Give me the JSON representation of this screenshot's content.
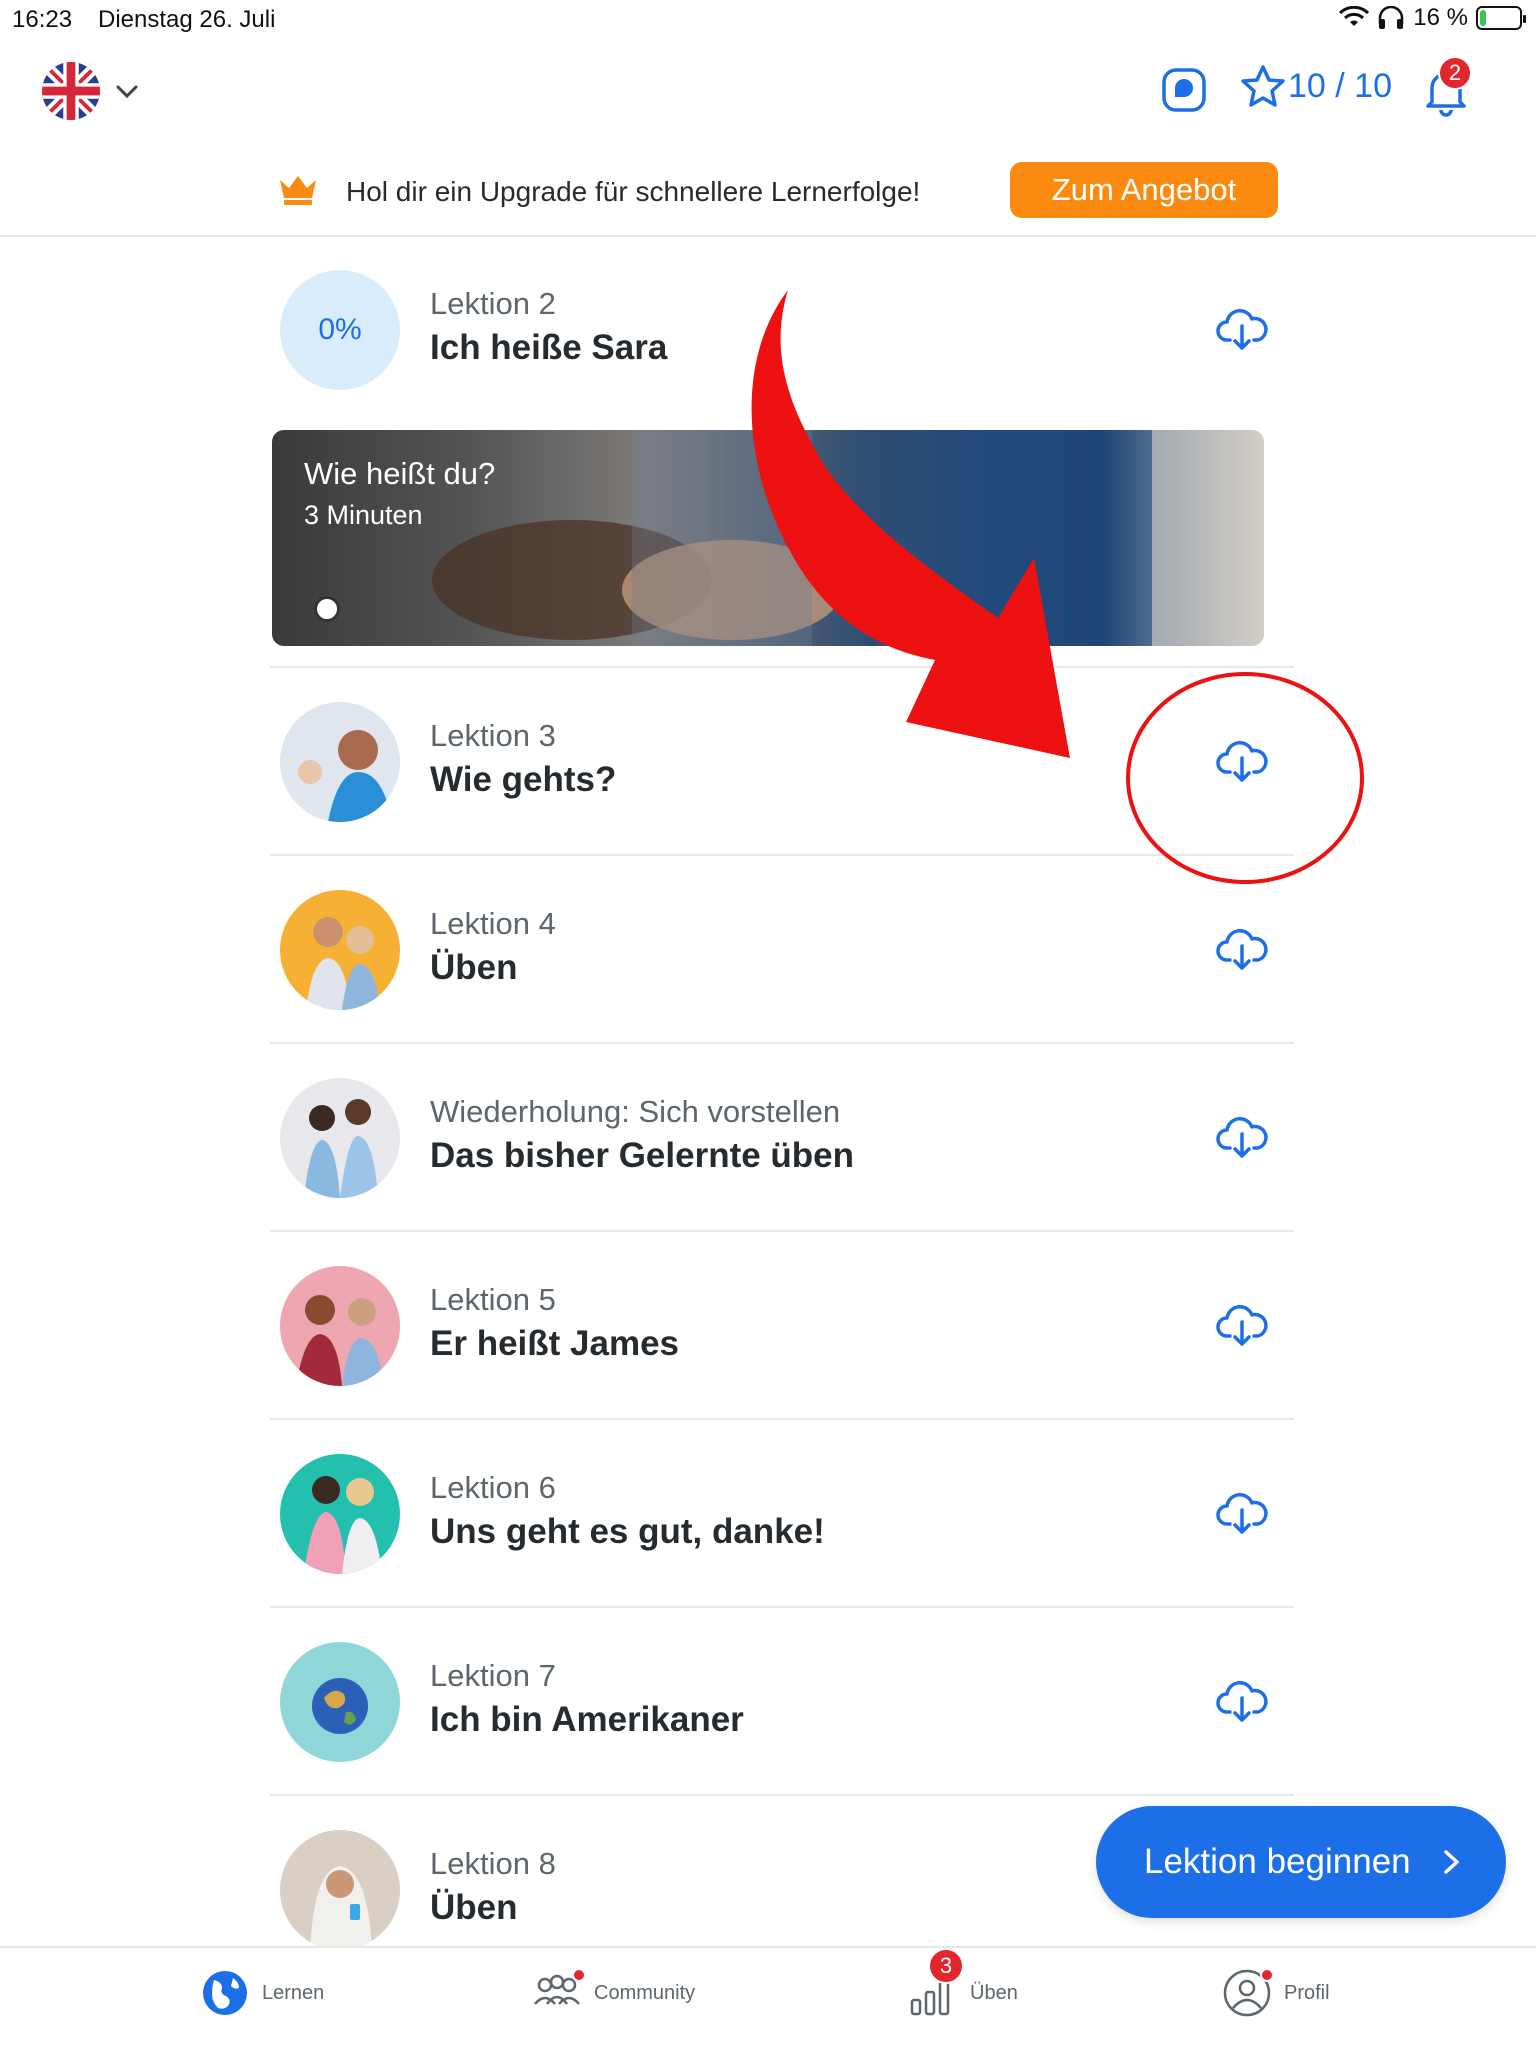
{
  "status_bar": {
    "time": "16:23",
    "date": "Dienstag 26. Juli",
    "battery": "16 %"
  },
  "header": {
    "language_icon": "uk-flag-icon",
    "stars": "10 / 10",
    "notifications_count": "2"
  },
  "upgrade": {
    "text": "Hol dir ein Upgrade für schnellere Lernerfolge!",
    "button": "Zum Angebot"
  },
  "lessons": [
    {
      "subtitle": "Lektion 2",
      "title": "Ich heiße Sara",
      "progress": "0%"
    },
    {
      "subtitle": "Lektion 3",
      "title": "Wie gehts?"
    },
    {
      "subtitle": "Lektion 4",
      "title": "Üben"
    },
    {
      "subtitle": "Wiederholung: Sich vorstellen",
      "title": "Das bisher Gelernte üben"
    },
    {
      "subtitle": "Lektion 5",
      "title": "Er heißt James"
    },
    {
      "subtitle": "Lektion 6",
      "title": "Uns geht es gut, danke!"
    },
    {
      "subtitle": "Lektion 7",
      "title": "Ich bin Amerikaner"
    },
    {
      "subtitle": "Lektion 8",
      "title": "Üben"
    }
  ],
  "video_card": {
    "title": "Wie heißt du?",
    "duration": "3 Minuten"
  },
  "cta": {
    "label": "Lektion beginnen"
  },
  "bottom_nav": {
    "items": [
      {
        "label": "Lernen"
      },
      {
        "label": "Community"
      },
      {
        "label": "Üben",
        "badge": "3"
      },
      {
        "label": "Profil"
      }
    ]
  },
  "colors": {
    "accent": "#1d6fe8",
    "offer": "#fb8b10",
    "badge": "#e3262c",
    "annotation": "#ee1111"
  }
}
